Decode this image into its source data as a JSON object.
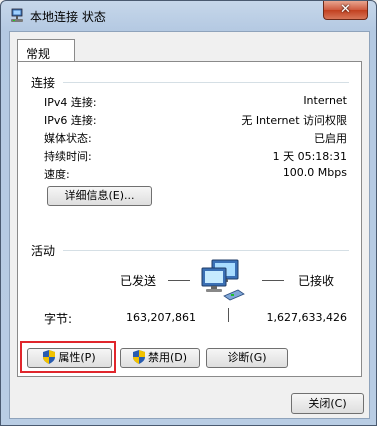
{
  "window": {
    "title": "本地连接 状态",
    "close_label": "✕",
    "title_icon": "network-icon"
  },
  "tabs": [
    {
      "label": "常规"
    }
  ],
  "connection": {
    "group_label": "连接",
    "rows": [
      {
        "label": "IPv4 连接:",
        "value": "Internet"
      },
      {
        "label": "IPv6 连接:",
        "value": "无 Internet 访问权限"
      },
      {
        "label": "媒体状态:",
        "value": "已启用"
      },
      {
        "label": "持续时间:",
        "value": "1 天 05:18:31"
      },
      {
        "label": "速度:",
        "value": "100.0 Mbps"
      }
    ],
    "details_button": "详细信息(E)..."
  },
  "activity": {
    "group_label": "活动",
    "sent_label": "已发送",
    "received_label": "已接收",
    "bytes_label": "字节:",
    "bytes_sent": "163,207,861",
    "bytes_received": "1,627,633,426",
    "icon": "network-computers-icon"
  },
  "actions": {
    "properties": "属性(P)",
    "disable": "禁用(D)",
    "diagnose": "诊断(G)",
    "shield_icon": "uac-shield-icon"
  },
  "footer": {
    "close": "关闭(C)"
  },
  "colors": {
    "highlight": "#e0262c",
    "titlebar": "#b9cde4",
    "close_button": "#c2401f"
  }
}
